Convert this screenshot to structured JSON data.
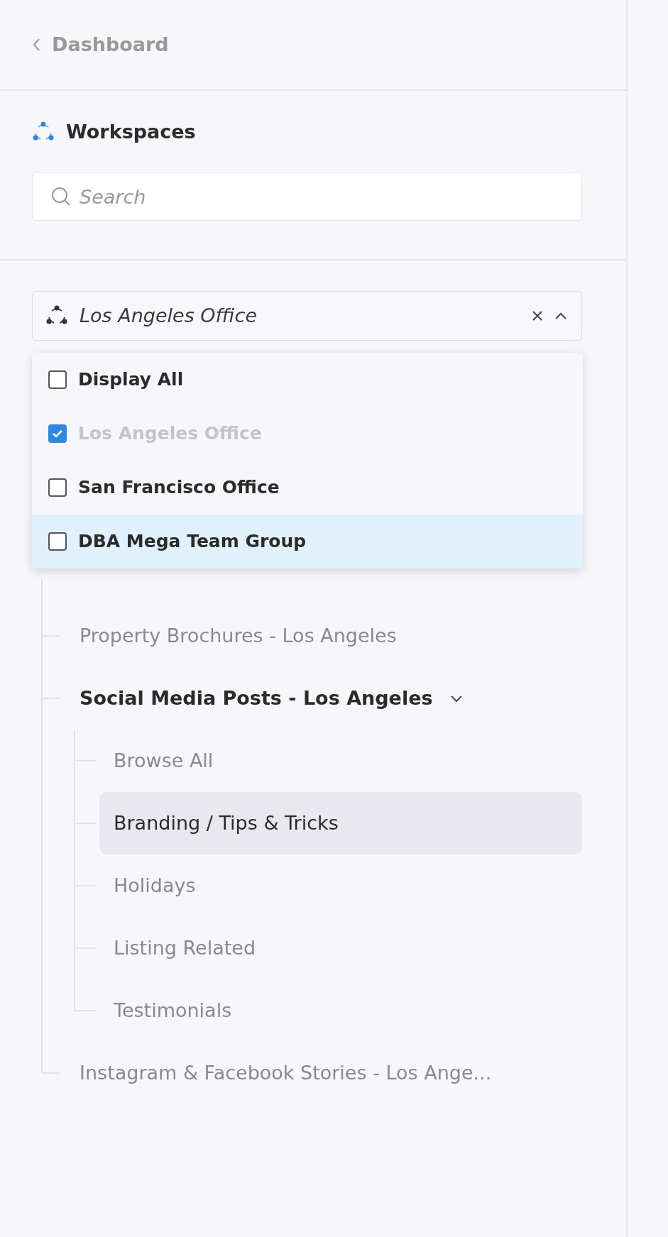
{
  "back_link": {
    "label": "Dashboard"
  },
  "workspaces": {
    "title": "Workspaces",
    "search": {
      "placeholder": "Search"
    }
  },
  "workspace_select": {
    "value": "Los Angeles Office",
    "expanded": true,
    "options": [
      {
        "label": "Display All",
        "checked": false,
        "disabled": false,
        "highlighted": false
      },
      {
        "label": "Los Angeles Office",
        "checked": true,
        "disabled": true,
        "highlighted": false
      },
      {
        "label": "San Francisco Office",
        "checked": false,
        "disabled": false,
        "highlighted": false
      },
      {
        "label": "DBA Mega Team Group",
        "checked": false,
        "disabled": false,
        "highlighted": true
      }
    ]
  },
  "tree": [
    {
      "label": "Property Brochures - Los Angeles",
      "selected": false
    },
    {
      "label": "Social Media Posts - Los Angeles",
      "selected": false,
      "expanded": true,
      "children": [
        {
          "label": "Browse All",
          "selected": false
        },
        {
          "label": "Branding / Tips & Tricks",
          "selected": true
        },
        {
          "label": "Holidays",
          "selected": false
        },
        {
          "label": "Listing Related",
          "selected": false
        },
        {
          "label": "Testimonials",
          "selected": false
        }
      ]
    },
    {
      "label": "Instagram & Facebook Stories - Los Ange...",
      "selected": false
    }
  ]
}
